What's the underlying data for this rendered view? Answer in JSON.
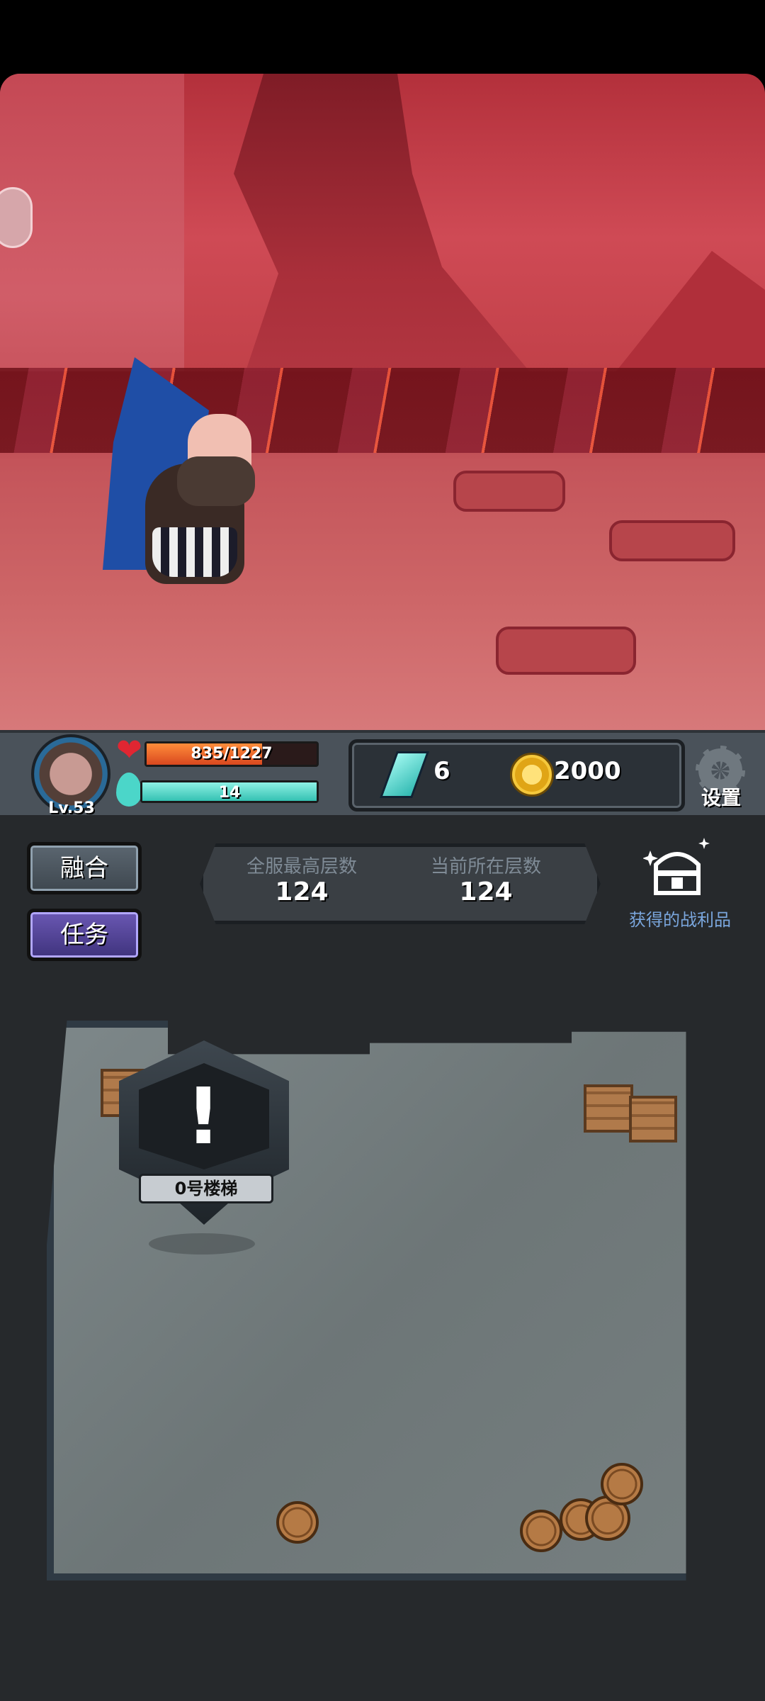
{
  "player": {
    "level": "Lv.53"
  },
  "stats": {
    "hp_text": "835/1227",
    "hp_fraction": 0.68,
    "mp_text": "14",
    "mp_fraction": 1.0
  },
  "currency": {
    "gems": "6",
    "gold": "2000"
  },
  "settings_label": "设置",
  "buttons": {
    "merge": "融合",
    "task": "任务"
  },
  "floors": {
    "server_max_label": "全服最高层数",
    "server_max_value": "124",
    "current_label": "当前所在层数",
    "current_value": "124"
  },
  "loot_label": "获得的战利品",
  "map": {
    "stairs_label": "0号楼梯",
    "alert_glyph": "!"
  },
  "colors": {
    "hp": "#e0451f",
    "mp": "#34c1b2",
    "accent_task": "#5a49a3"
  }
}
